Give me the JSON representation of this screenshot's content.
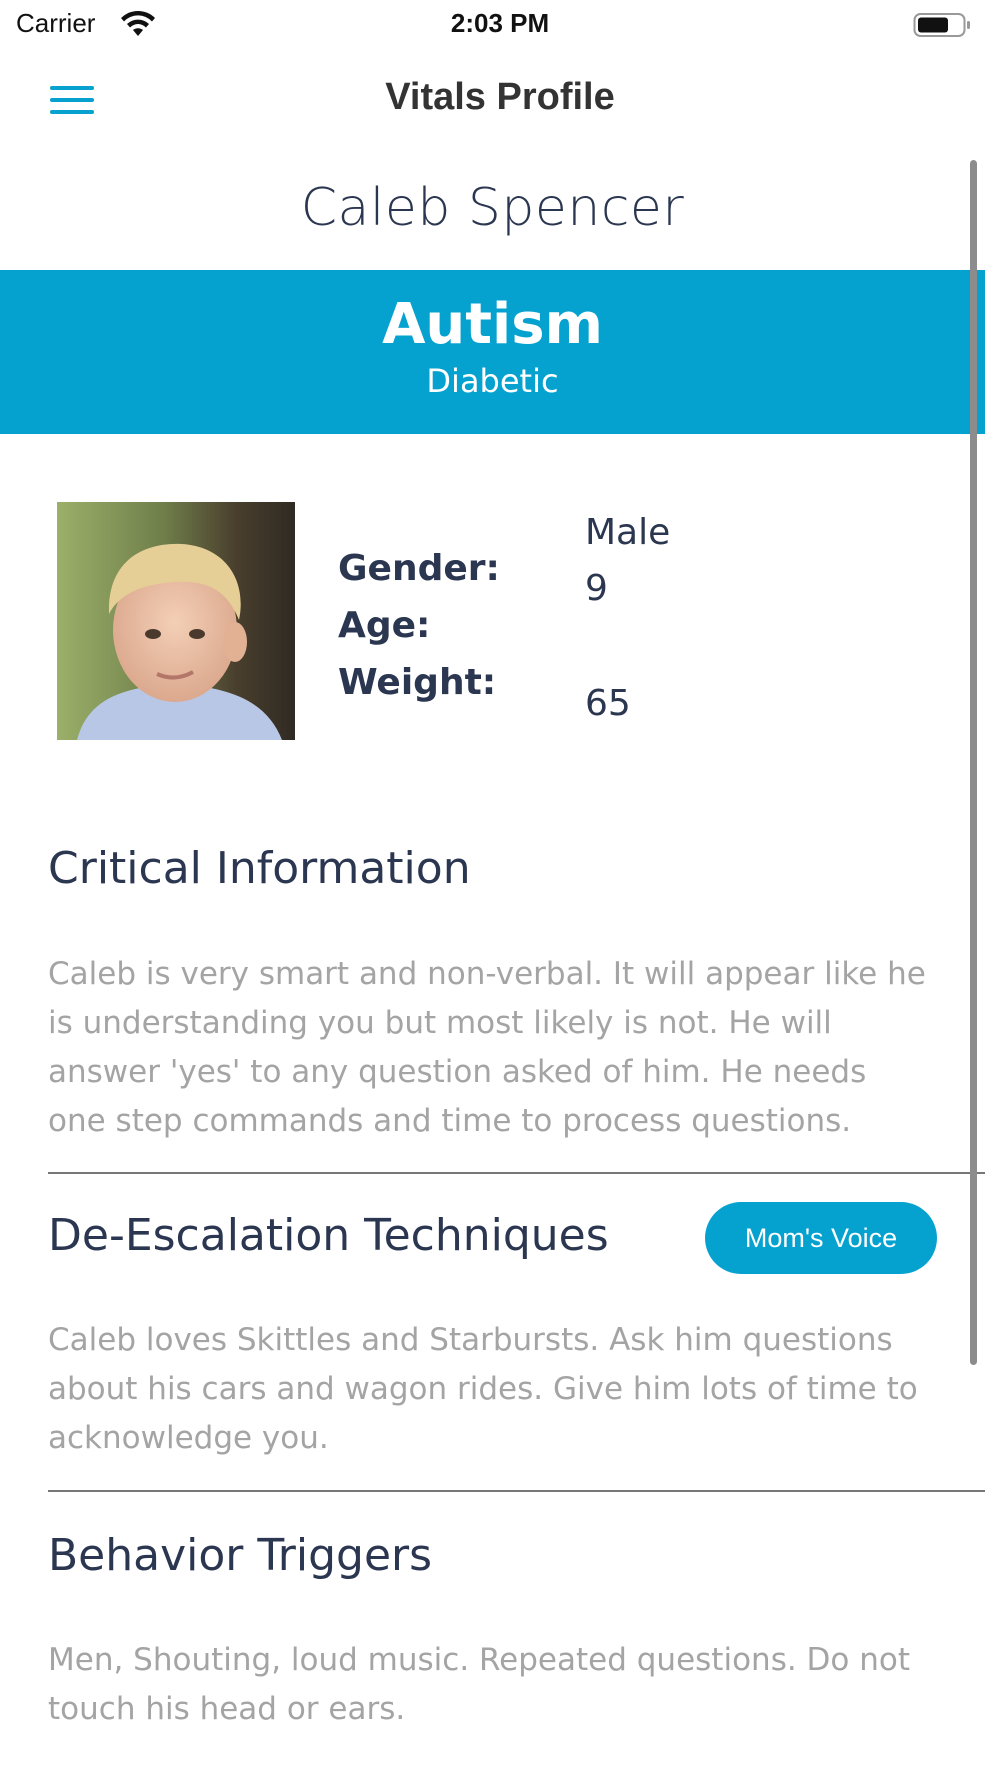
{
  "status_bar": {
    "carrier": "Carrier",
    "time": "2:03 PM",
    "wifi_icon": "wifi-icon",
    "battery_icon": "battery-icon"
  },
  "nav": {
    "title": "Vitals Profile",
    "menu_icon": "hamburger-menu-icon",
    "accent_color": "#06a1cf"
  },
  "profile": {
    "name": "Caleb Spencer",
    "condition_primary": "Autism",
    "condition_secondary": "Diabetic",
    "banner_color": "#05a2d0",
    "labels": {
      "gender": "Gender:",
      "age": "Age:",
      "weight": "Weight:"
    },
    "values": {
      "gender": "Male",
      "age": "9",
      "weight": "65"
    }
  },
  "sections": {
    "critical": {
      "title": "Critical Information",
      "body": "Caleb is very smart and non-verbal.  It will appear like he is understanding you but most likely is not.  He will answer 'yes' to any question asked of him.  He needs one step commands and time to process questions."
    },
    "deescalation": {
      "title": "De-Escalation Techniques",
      "button_label": "Mom's Voice",
      "body": "Caleb loves Skittles and Starbursts. Ask him questions about his cars and wagon rides. Give him lots of time to acknowledge you."
    },
    "triggers": {
      "title": "Behavior Triggers",
      "body": "Men, Shouting, loud music. Repeated questions. Do not touch his head or ears."
    }
  }
}
